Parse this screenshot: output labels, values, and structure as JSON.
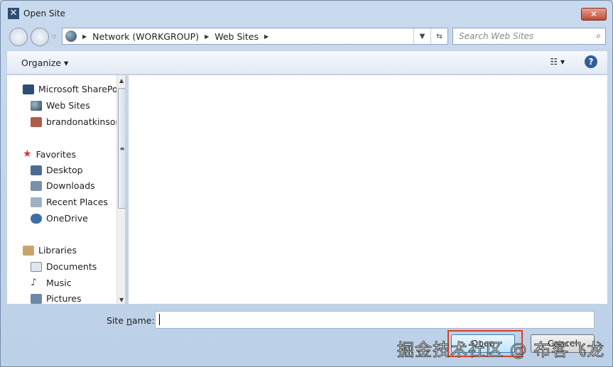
{
  "window": {
    "title": "Open Site",
    "close_label": "✕"
  },
  "address": {
    "segments": [
      "Network (WORKGROUP)",
      "Web Sites"
    ]
  },
  "search": {
    "placeholder": "Search Web Sites"
  },
  "toolbar": {
    "organize": "Organize ▾",
    "views": "☷ ▾",
    "help": "?"
  },
  "nav": {
    "sharepoint": {
      "label": "Microsoft SharePoint",
      "children": [
        "Web Sites",
        "brandonatkinson"
      ]
    },
    "favorites": {
      "label": "Favorites",
      "children": [
        "Desktop",
        "Downloads",
        "Recent Places",
        "OneDrive"
      ]
    },
    "libraries": {
      "label": "Libraries",
      "children": [
        "Documents",
        "Music",
        "Pictures"
      ]
    }
  },
  "footer": {
    "site_name_prefix": "Site ",
    "site_name_u": "n",
    "site_name_suffix": "ame:",
    "site_name_value": "",
    "open": "Open",
    "cancel": "Cancel"
  },
  "watermark": "掘金技术社区 @ 布客飞龙"
}
